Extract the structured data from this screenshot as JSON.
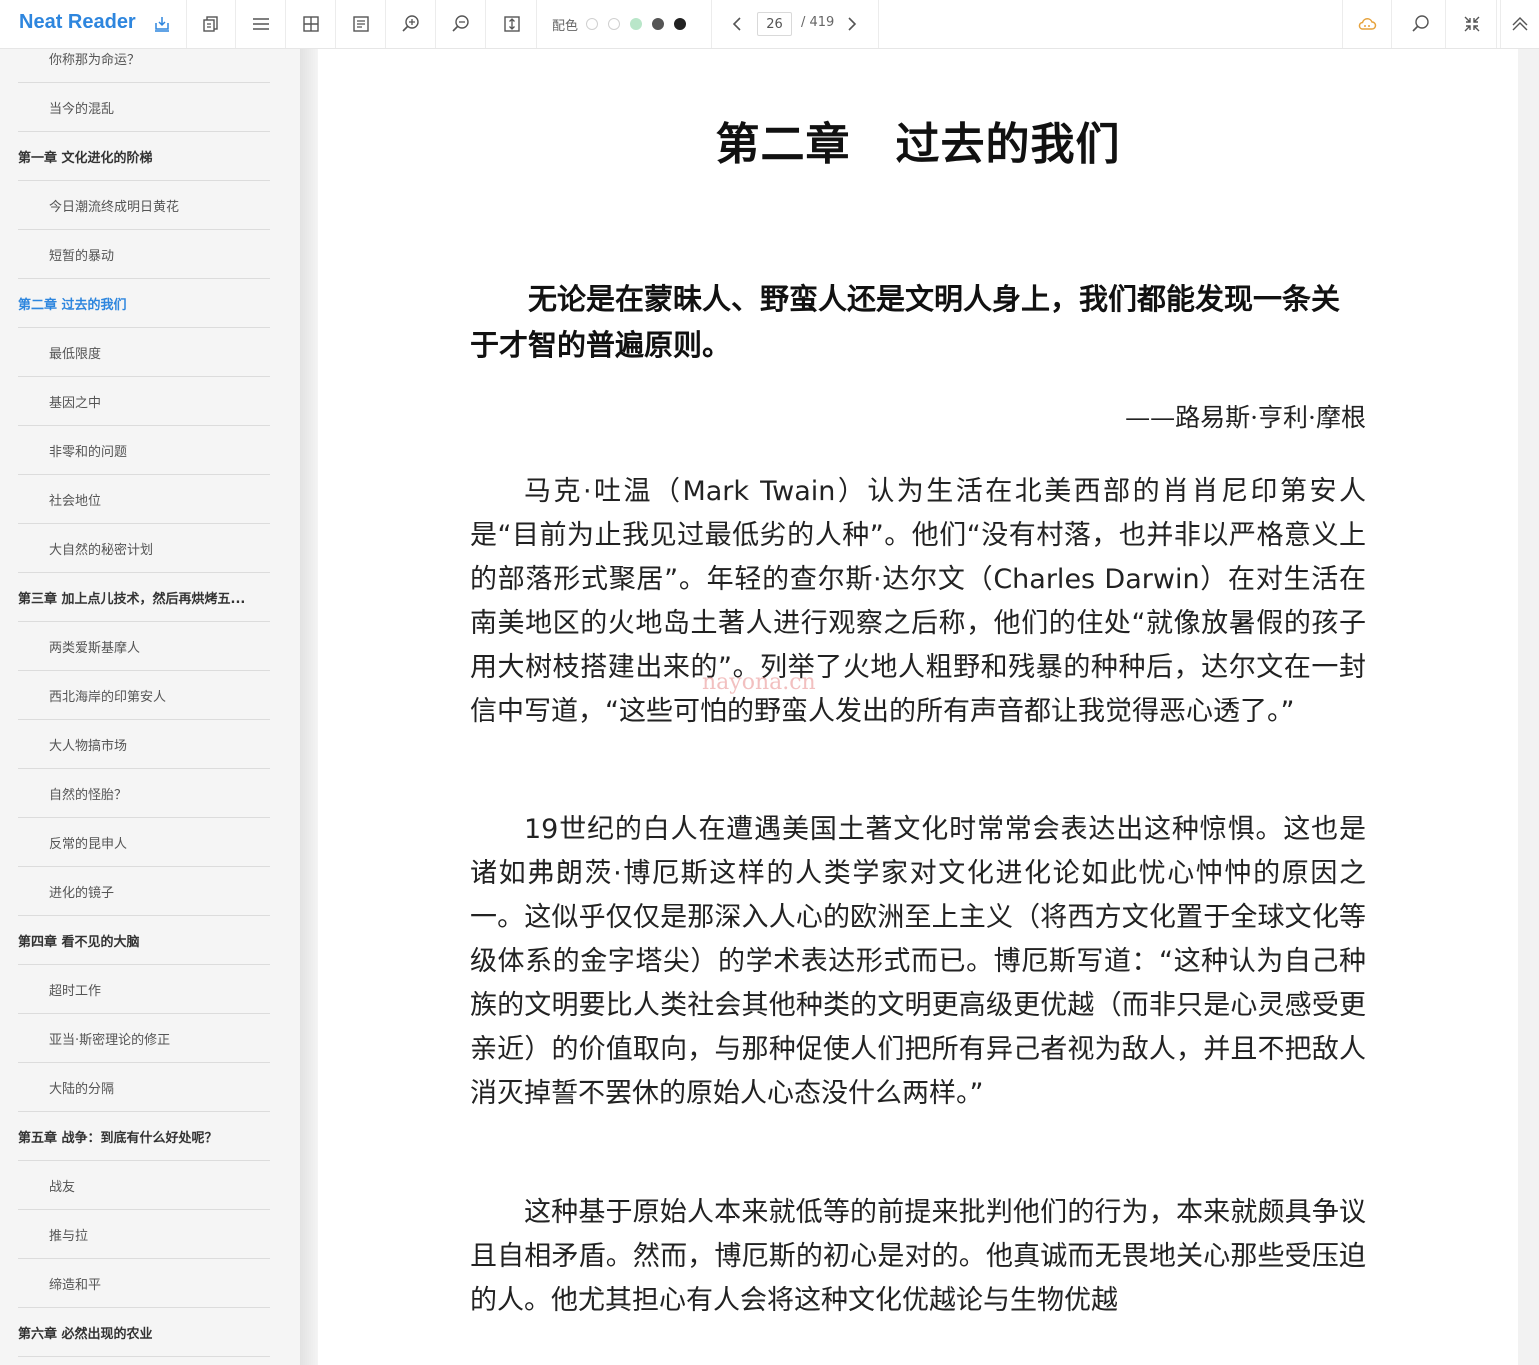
{
  "app": {
    "brand": "Neat Reader",
    "palette_label": "配色",
    "palette_colors": [
      "#ffffff",
      "#ffffff",
      "#b9e6c9",
      "#555555",
      "#222222"
    ],
    "accent": "#2e86de",
    "page_current": "26",
    "page_total": "/ 419"
  },
  "icons": {
    "toolbar": [
      "library-icon",
      "copy-icon",
      "toc-icon",
      "grid-icon",
      "notes-icon",
      "zoom-in-icon",
      "zoom-out-icon",
      "fit-icon"
    ],
    "right": [
      "cloud-icon",
      "search-icon",
      "collapse-icon",
      "chevron-up-icon"
    ]
  },
  "toc": [
    {
      "label": "你称那为命运？",
      "level": "sub"
    },
    {
      "label": "当今的混乱",
      "level": "sub"
    },
    {
      "label": "第一章 文化进化的阶梯",
      "level": "chapter"
    },
    {
      "label": "今日潮流终成明日黄花",
      "level": "sub"
    },
    {
      "label": "短暂的暴动",
      "level": "sub"
    },
    {
      "label": "第二章 过去的我们",
      "level": "chapter",
      "active": true
    },
    {
      "label": "最低限度",
      "level": "sub"
    },
    {
      "label": "基因之中",
      "level": "sub"
    },
    {
      "label": "非零和的问题",
      "level": "sub"
    },
    {
      "label": "社会地位",
      "level": "sub"
    },
    {
      "label": "大自然的秘密计划",
      "level": "sub"
    },
    {
      "label": "第三章 加上点儿技术，然后再烘烤五...",
      "level": "chapter"
    },
    {
      "label": "两类爱斯基摩人",
      "level": "sub"
    },
    {
      "label": "西北海岸的印第安人",
      "level": "sub"
    },
    {
      "label": "大人物搞市场",
      "level": "sub"
    },
    {
      "label": "自然的怪胎？",
      "level": "sub"
    },
    {
      "label": "反常的昆申人",
      "level": "sub"
    },
    {
      "label": "进化的镜子",
      "level": "sub"
    },
    {
      "label": "第四章 看不见的大脑",
      "level": "chapter"
    },
    {
      "label": "超时工作",
      "level": "sub"
    },
    {
      "label": "亚当·斯密理论的修正",
      "level": "sub"
    },
    {
      "label": "大陆的分隔",
      "level": "sub"
    },
    {
      "label": "第五章 战争：到底有什么好处呢？",
      "level": "chapter"
    },
    {
      "label": "战友",
      "level": "sub"
    },
    {
      "label": "推与拉",
      "level": "sub"
    },
    {
      "label": "缔造和平",
      "level": "sub"
    },
    {
      "label": "第六章 必然出现的农业",
      "level": "chapter"
    }
  ],
  "content": {
    "chapter_title": "第二章　过去的我们",
    "epigraph": "无论是在蒙昧人、野蛮人还是文明人身上，我们都能发现一条关于才智的普遍原则。",
    "attribution": "——路易斯·亨利·摩根",
    "p1": "马克·吐温（Mark Twain）认为生活在北美西部的肖肖尼印第安人是“目前为止我见过最低劣的人种”。他们“没有村落，也并非以严格意义上的部落形式聚居”。年轻的查尔斯·达尔文（Charles Darwin）在对生活在南美地区的火地岛土著人进行观察之后称，他们的住处“就像放暑假的孩子用大树枝搭建出来的”。列举了火地人粗野和残暴的种种后，达尔文在一封信中写道，“这些可怕的野蛮人发出的所有声音都让我觉得恶心透了。”",
    "p2a": "19世纪的白人在遭遇美国土著文化时常常会表达出这种惊惧。这也是诸如弗朗茨·博厄斯这样的人类学家对文化进化论如此忧心忡忡的原因之一。这似乎仅仅是那深入人心的欧洲至上主义（",
    "p2b": "将西方文化置于全球文化等级体系的金字塔尖",
    "p2c": "）的学术表达形式而已。博厄斯写道：“这种认为自己种族的文明要比人类社会其他种类的文明更高级更优越（",
    "p2d": "而非只是心灵感受更亲近",
    "p2e": "）的价值取向，与那种促使人们把所有异己者视为敌人，并且不把敌人消灭掉誓不罢休的原始人心态没什么两样。”",
    "p3": "这种基于原始人本来就低等的前提来批判他们的行为，本来就颇具争议且自相矛盾。然而，博厄斯的初心是对的。他真诚而无畏地关心那些受压迫的人。他尤其担心有人会将这种文化优越论与生物优越",
    "watermark": "nayona.cn"
  }
}
